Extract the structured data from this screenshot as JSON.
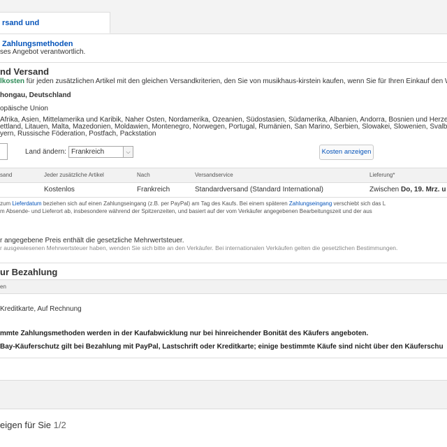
{
  "tabs": {
    "shipping_payment": "rsand und Zahlungsmethoden"
  },
  "seller": {
    "responsible": "ses Angebot verantwortlich."
  },
  "shipping": {
    "heading": "nd Versand",
    "free_label": "lkosten",
    "free_rest": " für jeden zusätzlichen Artikel mit den gleichen Versandkriterien, den Sie von musikhaus-kirstein kaufen, wenn Sie für Ihren Einkauf den Wa",
    "location": "hongau, Deutschland",
    "eu": "opäische Union",
    "excluded_1": "Afrika, Asien, Mittelamerika und Karibik, Naher Osten, Nordamerika, Ozeanien, Südostasien, Südamerika, Albanien, Andorra, Bosnien und Herzeg",
    "excluded_2": "ettland, Litauen, Malta, Mazedonien, Moldawien, Montenegro, Norwegen, Portugal, Rumänien, San Marino, Serbien, Slowakei, Slowenien, Svalbar",
    "excluded_3": "yern, Russische Föderation, Postfach, Packstation",
    "quantity_value": "",
    "change_country_label": "Land ändern:",
    "country_selected": "Frankreich",
    "show_costs_button": "Kosten anzeigen"
  },
  "table": {
    "headers": [
      "sand",
      "Jeder zusätzliche Artikel",
      "Nach",
      "Versandservice",
      "Lieferung*"
    ],
    "row": {
      "additional": "Kostenlos",
      "to": "Frankreich",
      "service": "Standardversand (Standard International)",
      "delivery_prefix": "Zwischen ",
      "delivery_bold": "Do, 19. Mrz. u"
    }
  },
  "note": {
    "line1_a": "zum ",
    "line1_link1": "Lieferdatum",
    "line1_b": " beziehen sich auf einen Zahlungseingang (z.B. per PayPal) am Tag des Kaufs. Bei einem späteren ",
    "line1_link2": "Zahlungseingang",
    "line1_c": " verschiebt sich das L",
    "line2": "m Absende- und Lieferort ab, insbesondere während der Spitzenzeiten, und basiert auf der vom Verkäufer angegebenen Bearbeitungszeit und der aus"
  },
  "vat": {
    "line1": "r angegebene Preis enthält die gesetzliche Mehrwertsteuer.",
    "line2": "r ausgewiesenen Mehrwertsteuer haben, wenden Sie sich bitte an den Verkäufer. Bei internationalen Verkäufen gelten die gesetzlichen Bestimmungen."
  },
  "payment": {
    "heading": "ur Bezahlung",
    "column_header": "en",
    "methods": "Kreditkarte, Auf Rechnung",
    "notice1": "mmte Zahlungsmethoden werden in der Kaufabwicklung nur bei hinreichender Bonität des Käufers angeboten.",
    "notice2": "Bay-Käuferschutz gilt bei Bezahlung mit PayPal, Lastschrift oder Kreditkarte; einige bestimmte Käufe sind nicht über den Käuferschu"
  },
  "ads": {
    "title": "eigen für Sie",
    "pager": "1/2"
  }
}
